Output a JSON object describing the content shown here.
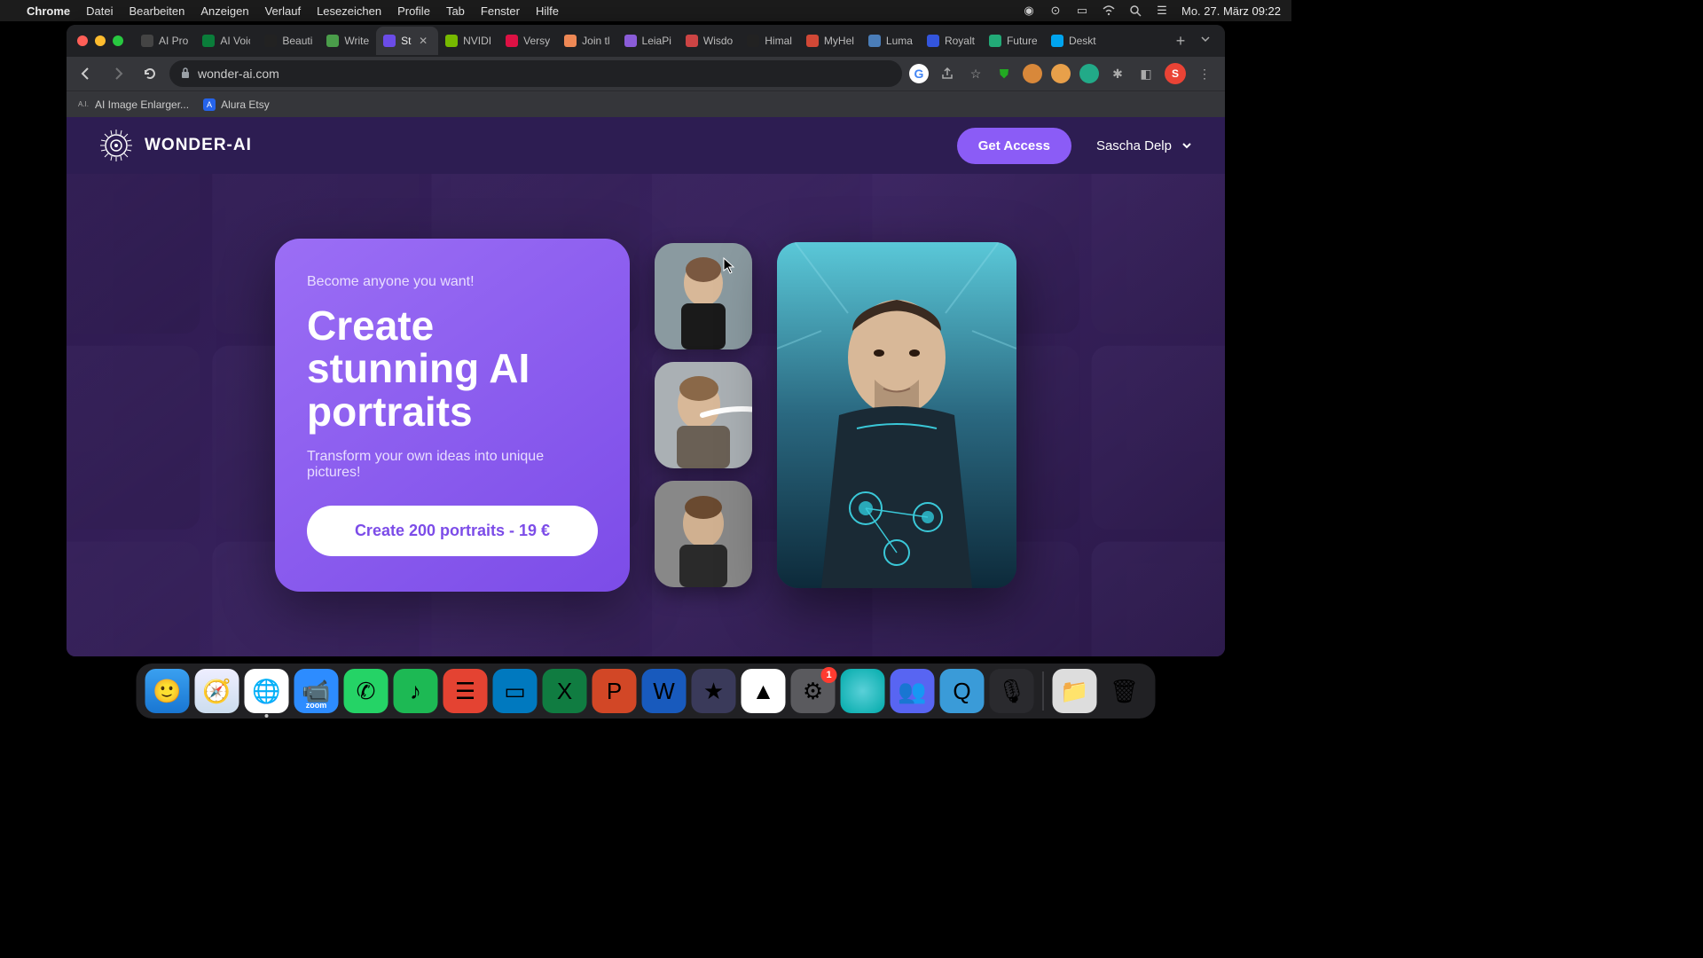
{
  "menubar": {
    "app": "Chrome",
    "items": [
      "Datei",
      "Bearbeiten",
      "Anzeigen",
      "Verlauf",
      "Lesezeichen",
      "Profile",
      "Tab",
      "Fenster",
      "Hilfe"
    ],
    "datetime": "Mo. 27. März  09:22"
  },
  "browser": {
    "tabs": [
      {
        "title": "AI Pro",
        "favicon_bg": "#444"
      },
      {
        "title": "AI Voic",
        "favicon_bg": "#0a7d3a"
      },
      {
        "title": "Beauti",
        "favicon_bg": "#222"
      },
      {
        "title": "Write",
        "favicon_bg": "#4a9d4a"
      },
      {
        "title": "Sta",
        "favicon_bg": "#6b4ce8",
        "active": true
      },
      {
        "title": "NVIDI",
        "favicon_bg": "#76b900"
      },
      {
        "title": "Versy",
        "favicon_bg": "#d14"
      },
      {
        "title": "Join tl",
        "favicon_bg": "#e85"
      },
      {
        "title": "LeiaPi",
        "favicon_bg": "#8a5cd8"
      },
      {
        "title": "Wisdo",
        "favicon_bg": "#c44"
      },
      {
        "title": "Himal",
        "favicon_bg": "#222"
      },
      {
        "title": "MyHel",
        "favicon_bg": "#d14836"
      },
      {
        "title": "Luma",
        "favicon_bg": "#4a7db8"
      },
      {
        "title": "Royalt",
        "favicon_bg": "#3355dd"
      },
      {
        "title": "Future",
        "favicon_bg": "#2a7"
      },
      {
        "title": "Deskt",
        "favicon_bg": "#00a4ef"
      }
    ],
    "url": "wonder-ai.com",
    "profile_initial": "S",
    "bookmarks": [
      {
        "title": "AI Image Enlarger...",
        "icon_text": "A.I."
      },
      {
        "title": "Alura Etsy",
        "icon_bg": "#2563eb",
        "icon_text": "A"
      }
    ]
  },
  "site": {
    "brand": "WONDER-AI",
    "cta_header": "Get Access",
    "user_name": "Sascha Delp",
    "hero": {
      "kicker": "Become anyone you want!",
      "title": "Create stunning AI portraits",
      "subtitle": "Transform your own ideas into unique pictures!",
      "cta": "Create 200 portraits - 19 €"
    }
  },
  "dock": {
    "items": [
      {
        "name": "finder",
        "bg": "linear-gradient(#3aa0f0,#1976d2)",
        "glyph": "🙂"
      },
      {
        "name": "safari",
        "bg": "linear-gradient(#eef,#cde)",
        "glyph": "🧭"
      },
      {
        "name": "chrome",
        "bg": "#fff",
        "glyph": "🌐",
        "running": true
      },
      {
        "name": "zoom",
        "bg": "#2d8cff",
        "glyph": "📹",
        "label": "zoom"
      },
      {
        "name": "whatsapp",
        "bg": "#25d366",
        "glyph": "✆"
      },
      {
        "name": "spotify",
        "bg": "#1db954",
        "glyph": "♪"
      },
      {
        "name": "todoist",
        "bg": "#e44332",
        "glyph": "☰"
      },
      {
        "name": "trello",
        "bg": "#0079bf",
        "glyph": "▭"
      },
      {
        "name": "excel",
        "bg": "#107c41",
        "glyph": "X"
      },
      {
        "name": "powerpoint",
        "bg": "#d24726",
        "glyph": "P"
      },
      {
        "name": "word",
        "bg": "#185abd",
        "glyph": "W"
      },
      {
        "name": "imovie",
        "bg": "#3a3a5a",
        "glyph": "★"
      },
      {
        "name": "drive",
        "bg": "#fff",
        "glyph": "▲"
      },
      {
        "name": "settings",
        "bg": "#5a5a5e",
        "glyph": "⚙",
        "badge": "1"
      },
      {
        "name": "app-teal",
        "bg": "radial-gradient(#5ad0d8,#0aa)",
        "glyph": ""
      },
      {
        "name": "discord",
        "bg": "#5865f2",
        "glyph": "👥"
      },
      {
        "name": "quicktime",
        "bg": "#3a9bd8",
        "glyph": "Q"
      },
      {
        "name": "audio",
        "bg": "#2a2a2e",
        "glyph": "🎙"
      }
    ],
    "right_items": [
      {
        "name": "downloads",
        "bg": "#ddd",
        "glyph": "📁"
      },
      {
        "name": "trash",
        "bg": "transparent",
        "glyph": "🗑"
      }
    ]
  }
}
